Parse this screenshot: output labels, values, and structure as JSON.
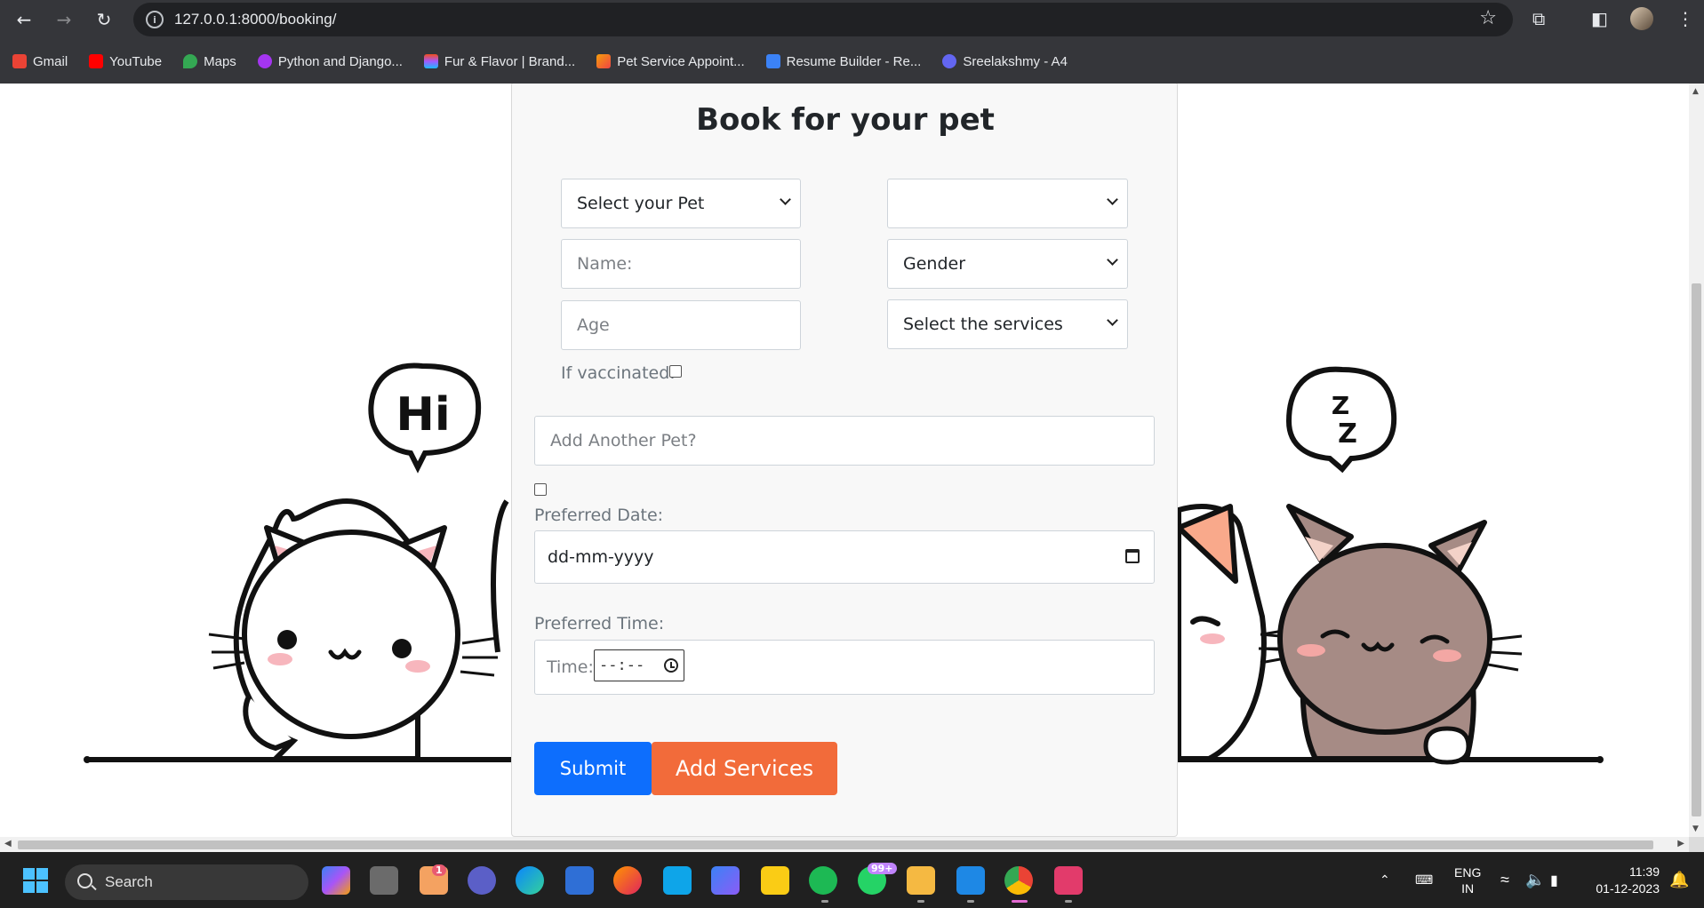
{
  "browser": {
    "url": "127.0.0.1:8000/booking/",
    "bookmarks": [
      {
        "label": "Gmail",
        "icon": "gmail-icon",
        "color": "#ea4335"
      },
      {
        "label": "YouTube",
        "icon": "youtube-icon",
        "color": "#ff0000"
      },
      {
        "label": "Maps",
        "icon": "maps-icon",
        "color": "#34a853"
      },
      {
        "label": "Python and Django...",
        "icon": "udemy-icon",
        "color": "#a435f0"
      },
      {
        "label": "Fur & Flavor | Brand...",
        "icon": "figma-icon",
        "color": "#f24e1e"
      },
      {
        "label": "Pet Service Appoint...",
        "icon": "pen-icon",
        "color": "#f59e0b"
      },
      {
        "label": "Resume Builder - Re...",
        "icon": "resume-icon",
        "color": "#3b82f6"
      },
      {
        "label": "Sreelakshmy - A4",
        "icon": "document-icon",
        "color": "#6366f1"
      }
    ]
  },
  "form": {
    "title": "Book for your pet",
    "pet_select": "Select your Pet",
    "breed_select": "",
    "name_placeholder": "Name:",
    "gender_select": "Gender",
    "age_placeholder": "Age",
    "services_select": "Select the services",
    "vaccinated_label": "If vaccinated:",
    "another_pet_placeholder": "Add Another Pet?",
    "date_label": "Preferred Date:",
    "date_value": "dd-mm-yyyy",
    "time_label": "Preferred Time:",
    "time_inner_label": "Time:",
    "time_value": "--:--",
    "submit_label": "Submit",
    "add_services_label": "Add Services"
  },
  "illustration": {
    "left_bubble": "Hi",
    "right_bubble_top": "Z",
    "right_bubble_bottom": "Z"
  },
  "colors": {
    "submit": "#0d6efd",
    "add_services": "#f26b3a"
  },
  "taskbar": {
    "search": "Search",
    "notif_badge_chat": "1",
    "whatsapp_badge": "99+",
    "language": "ENG",
    "region": "IN",
    "time": "11:39",
    "date": "01-12-2023"
  }
}
